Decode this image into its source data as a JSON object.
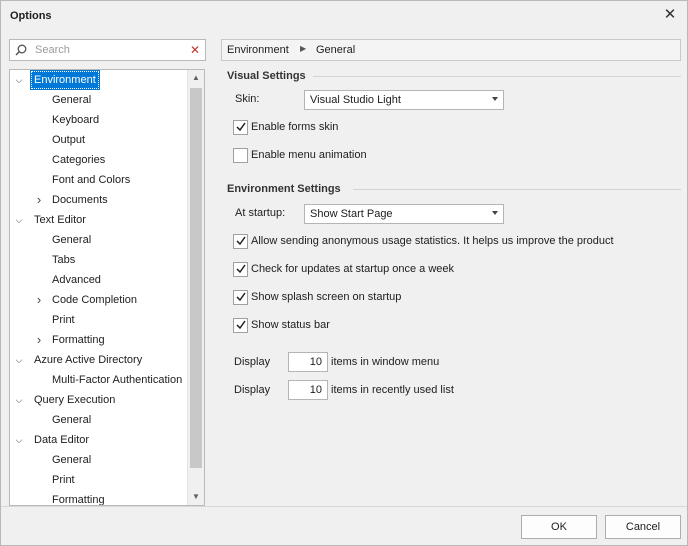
{
  "window": {
    "title": "Options"
  },
  "search": {
    "placeholder": "Search"
  },
  "tree": {
    "items": [
      {
        "label": "Environment",
        "level": 0,
        "expander": "expanded",
        "selected": true
      },
      {
        "label": "General",
        "level": 1,
        "expander": "none"
      },
      {
        "label": "Keyboard",
        "level": 1,
        "expander": "none"
      },
      {
        "label": "Output",
        "level": 1,
        "expander": "none"
      },
      {
        "label": "Categories",
        "level": 1,
        "expander": "none"
      },
      {
        "label": "Font and Colors",
        "level": 1,
        "expander": "none"
      },
      {
        "label": "Documents",
        "level": 1,
        "expander": "collapsed"
      },
      {
        "label": "Text Editor",
        "level": 0,
        "expander": "expanded"
      },
      {
        "label": "General",
        "level": 1,
        "expander": "none"
      },
      {
        "label": "Tabs",
        "level": 1,
        "expander": "none"
      },
      {
        "label": "Advanced",
        "level": 1,
        "expander": "none"
      },
      {
        "label": "Code Completion",
        "level": 1,
        "expander": "collapsed"
      },
      {
        "label": "Print",
        "level": 1,
        "expander": "none"
      },
      {
        "label": "Formatting",
        "level": 1,
        "expander": "collapsed"
      },
      {
        "label": "Azure Active Directory",
        "level": 0,
        "expander": "expanded"
      },
      {
        "label": "Multi-Factor Authentication",
        "level": 1,
        "expander": "none"
      },
      {
        "label": "Query Execution",
        "level": 0,
        "expander": "expanded"
      },
      {
        "label": "General",
        "level": 1,
        "expander": "none"
      },
      {
        "label": "Data Editor",
        "level": 0,
        "expander": "expanded"
      },
      {
        "label": "General",
        "level": 1,
        "expander": "none"
      },
      {
        "label": "Print",
        "level": 1,
        "expander": "none"
      },
      {
        "label": "Formatting",
        "level": 1,
        "expander": "none"
      }
    ]
  },
  "breadcrumb": {
    "root": "Environment",
    "current": "General"
  },
  "visual_settings": {
    "title": "Visual Settings",
    "skin_label": "Skin:",
    "skin_value": "Visual Studio Light",
    "enable_forms_skin": {
      "label": "Enable forms skin",
      "checked": true
    },
    "enable_menu_animation": {
      "label": "Enable menu animation",
      "checked": false
    }
  },
  "environment_settings": {
    "title": "Environment Settings",
    "startup_label": "At startup:",
    "startup_value": "Show Start Page",
    "anonymous_stats": {
      "label": "Allow sending anonymous usage statistics. It helps us improve the product",
      "checked": true
    },
    "check_updates": {
      "label": "Check for updates at startup once a week",
      "checked": true
    },
    "splash_screen": {
      "label": "Show splash screen on startup",
      "checked": true
    },
    "status_bar": {
      "label": "Show status bar",
      "checked": true
    },
    "window_menu": {
      "prefix": "Display",
      "value": "10",
      "suffix": "items in window menu"
    },
    "recent_list": {
      "prefix": "Display",
      "value": "10",
      "suffix": "items in recently used list"
    }
  },
  "buttons": {
    "ok": "OK",
    "cancel": "Cancel"
  },
  "colors": {
    "selection": "#0078d7",
    "check": "#202020",
    "clear_icon": "#c0392b"
  }
}
